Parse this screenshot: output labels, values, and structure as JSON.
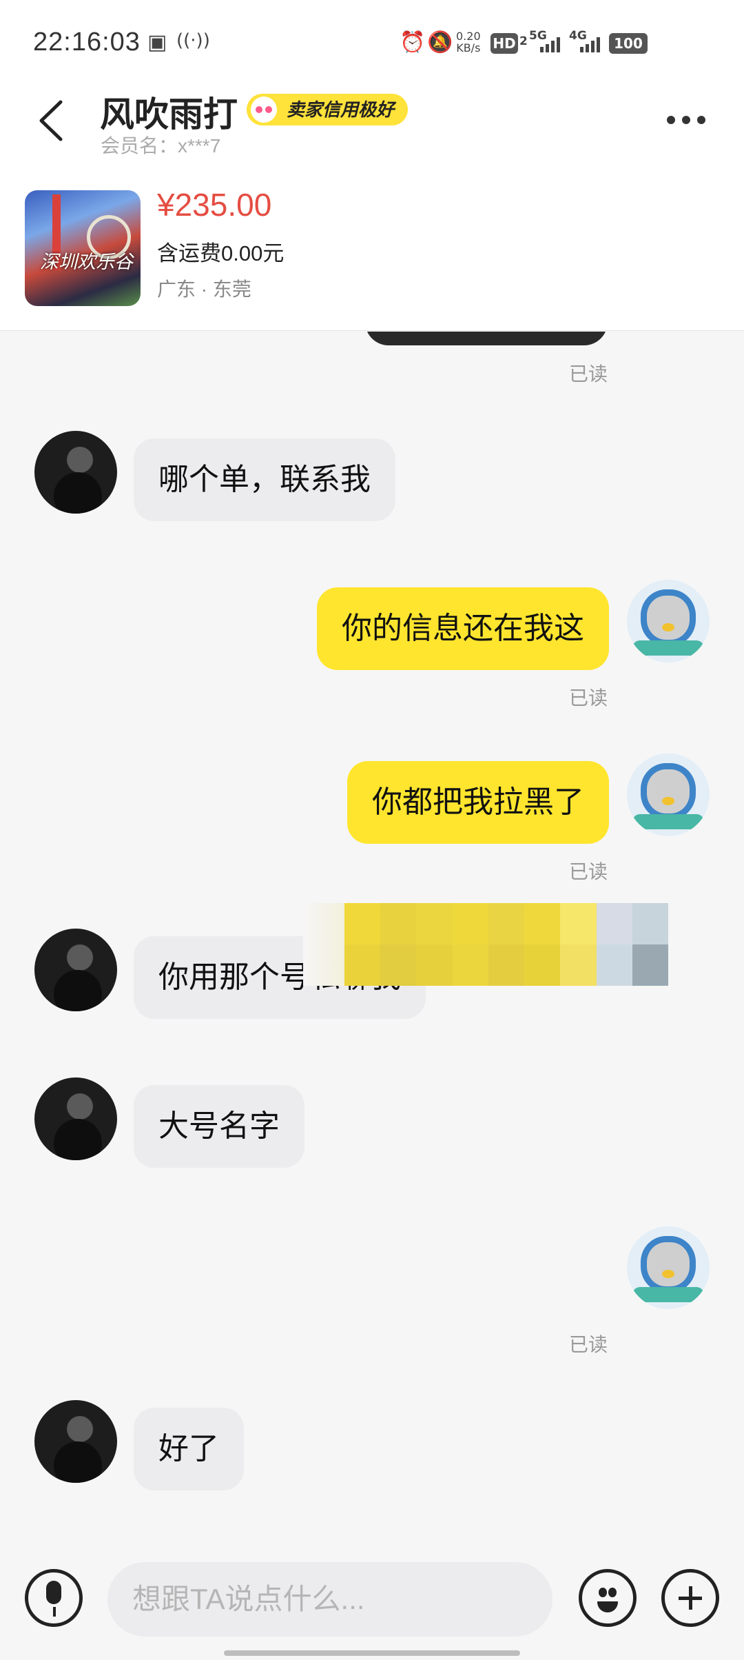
{
  "status_bar": {
    "time": "22:16:03",
    "net_speed_value": "0.20",
    "net_speed_unit": "KB/s",
    "hd_label": "HD",
    "hd_sub": "2",
    "net1": "5G",
    "net2": "4G",
    "battery": "100"
  },
  "header": {
    "title": "风吹雨打",
    "credit_badge": "卖家信用极好",
    "member": "会员名：x***7"
  },
  "product": {
    "image_text": "深圳欢乐谷",
    "price": "¥235.00",
    "shipping": "含运费0.00元",
    "location": "广东 · 东莞"
  },
  "chat": {
    "read_label": "已读",
    "messages": [
      {
        "from": "them",
        "text": "哪个单，联系我"
      },
      {
        "from": "me",
        "text": "你的信息还在我这"
      },
      {
        "from": "me",
        "text": "你都把我拉黑了"
      },
      {
        "from": "them",
        "text": "你用那个号私聊我"
      },
      {
        "from": "them",
        "text": "大号名字"
      },
      {
        "from": "them",
        "text": "好了"
      }
    ]
  },
  "input_bar": {
    "placeholder": "想跟TA说点什么..."
  },
  "colors": {
    "accent_yellow": "#ffe52e",
    "price_red": "#e54d42",
    "bubble_gray": "#ececee"
  },
  "icons": [
    "back-arrow-icon",
    "more-icon",
    "microphone-icon",
    "emoji-icon",
    "plus-icon"
  ]
}
